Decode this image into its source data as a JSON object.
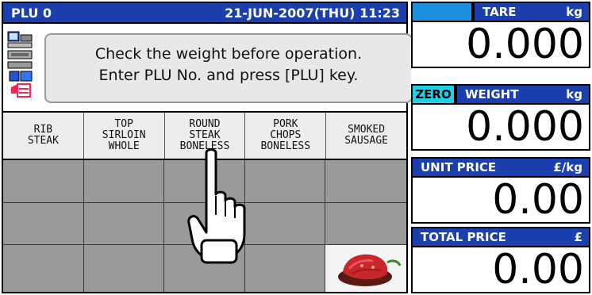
{
  "header": {
    "plu": "PLU 0",
    "datetime": "21-JUN-2007(THU) 11:23"
  },
  "message": {
    "line1": "Check the weight before operation.",
    "line2": "Enter PLU No. and press [PLU] key."
  },
  "tabs": [
    {
      "label": "RIB\nSTEAK"
    },
    {
      "label": "TOP\nSIRLOIN\nWHOLE"
    },
    {
      "label": "ROUND\nSTEAK\nBONELESS"
    },
    {
      "label": "PORK\nCHOPS\nBONELESS"
    },
    {
      "label": "SMOKED\nSAUSAGE"
    }
  ],
  "tare": {
    "label": "TARE",
    "unit": "kg",
    "value": "0.000"
  },
  "weight": {
    "zero": "ZERO",
    "label": "WEIGHT",
    "unit": "kg",
    "value": "0.000"
  },
  "unit_price": {
    "label": "UNIT PRICE",
    "unit": "£/kg",
    "value": "0.00"
  },
  "total_price": {
    "label": "TOTAL PRICE",
    "unit": "£",
    "value": "0.00"
  },
  "colors": {
    "accent": "#1c3fae",
    "grid": "#9a9a9a",
    "zero": "#1ed0e8",
    "blank": "#1e90e0"
  }
}
